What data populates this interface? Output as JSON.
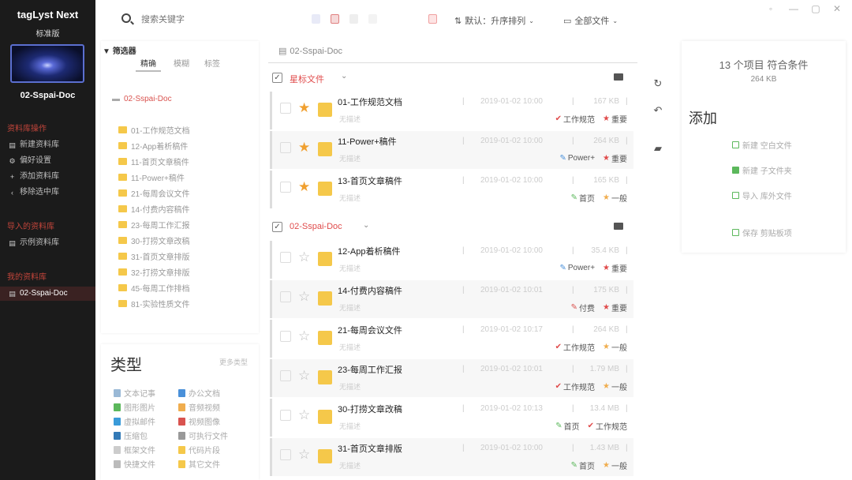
{
  "app": {
    "title": "tagLyst Next",
    "edition": "标准版",
    "library_name": "02-Sspai-Doc"
  },
  "sidebar": {
    "section1": "资料库操作",
    "items1": [
      {
        "icon": "library-icon",
        "label": "新建资料库"
      },
      {
        "icon": "gear-icon",
        "label": "偏好设置"
      },
      {
        "icon": "plus-icon",
        "label": "添加资料库"
      },
      {
        "icon": "back-icon",
        "label": "移除选中库"
      }
    ],
    "section2": "导入的资料库",
    "items2": [
      {
        "icon": "library-icon",
        "label": "示例资料库"
      }
    ],
    "section3": "我的资料库",
    "items3": [
      {
        "icon": "library-icon",
        "label": "02-Sspai-Doc"
      }
    ]
  },
  "toolbar": {
    "search_placeholder": "搜索关键字",
    "sort_label": "默认：升序排列",
    "scope_label": "全部文件",
    "sort_icon": "sort-icon",
    "scope_icon": "file-icon"
  },
  "filter": {
    "label": "筛选器",
    "tabs": [
      "精确",
      "模糊",
      "标签"
    ],
    "root": "02-Sspai-Doc",
    "folders": [
      "01-工作规范文档",
      "12-App着析稿件",
      "11-首页文章稿件",
      "11-Power+稿件",
      "21-每周会议文件",
      "14-付费内容稿件",
      "23-每周工作汇报",
      "30-打捞文章改稿",
      "31-首页文章排版",
      "32-打捞文章排版",
      "45-每周工作排档",
      "81-实验性质文件"
    ]
  },
  "types": {
    "title": "类型",
    "more": "更多类型",
    "items": [
      {
        "label": "文本记事",
        "color": "#9ab9d6"
      },
      {
        "label": "办公文档",
        "color": "#4a90d9"
      },
      {
        "label": "图形图片",
        "color": "#5cb85c"
      },
      {
        "label": "音频视频",
        "color": "#f0ad4e"
      },
      {
        "label": "虚拟邮件",
        "color": "#3a9bd9"
      },
      {
        "label": "视频图像",
        "color": "#d9534f"
      },
      {
        "label": "压缩包",
        "color": "#337ab7"
      },
      {
        "label": "可执行文件",
        "color": "#999999"
      },
      {
        "label": "框架文件",
        "color": "#cccccc"
      },
      {
        "label": "代码片段",
        "color": "#f5c84a"
      },
      {
        "label": "快捷文件",
        "color": "#bbbbbb"
      },
      {
        "label": "其它文件",
        "color": "#f5c84a"
      }
    ]
  },
  "list": {
    "path": "02-Sspai-Doc",
    "groups": [
      {
        "name": "星标文件",
        "rows": [
          {
            "name": "01-工作规范文档",
            "desc": "无描述",
            "date": "2019-01-02 10:00",
            "size": "167 KB",
            "starred": true,
            "tags": [
              {
                "label": "工作规范",
                "color": "#e04b4b",
                "icon": "check-tag-icon"
              },
              {
                "label": "重要",
                "color": "#e04b4b",
                "icon": "star-tag-icon"
              }
            ]
          },
          {
            "name": "11-Power+稿件",
            "desc": "无描述",
            "date": "2019-01-02 10:00",
            "size": "264 KB",
            "starred": true,
            "tags": [
              {
                "label": "Power+",
                "color": "#4a90d9",
                "icon": "pen-tag-icon"
              },
              {
                "label": "重要",
                "color": "#e04b4b",
                "icon": "star-tag-icon"
              }
            ]
          },
          {
            "name": "13-首页文章稿件",
            "desc": "无描述",
            "date": "2019-01-02 10:00",
            "size": "165 KB",
            "starred": true,
            "tags": [
              {
                "label": "首页",
                "color": "#5cb85c",
                "icon": "pen-tag-icon"
              },
              {
                "label": "一般",
                "color": "#f0ad4e",
                "icon": "star-tag-icon"
              }
            ]
          }
        ]
      },
      {
        "name": "02-Sspai-Doc",
        "rows": [
          {
            "name": "12-App着析稿件",
            "desc": "无描述",
            "date": "2019-01-02 10:00",
            "size": "35.4 KB",
            "starred": false,
            "tags": [
              {
                "label": "Power+",
                "color": "#4a90d9",
                "icon": "pen-tag-icon"
              },
              {
                "label": "重要",
                "color": "#e04b4b",
                "icon": "star-tag-icon"
              }
            ]
          },
          {
            "name": "14-付费内容稿件",
            "desc": "无描述",
            "date": "2019-01-02 10:01",
            "size": "175 KB",
            "starred": false,
            "tags": [
              {
                "label": "付费",
                "color": "#d9534f",
                "icon": "pen-tag-icon"
              },
              {
                "label": "重要",
                "color": "#e04b4b",
                "icon": "star-tag-icon"
              }
            ]
          },
          {
            "name": "21-每周会议文件",
            "desc": "无描述",
            "date": "2019-01-02 10:17",
            "size": "264 KB",
            "starred": false,
            "tags": [
              {
                "label": "工作规范",
                "color": "#e04b4b",
                "icon": "check-tag-icon"
              },
              {
                "label": "一般",
                "color": "#f0ad4e",
                "icon": "star-tag-icon"
              }
            ]
          },
          {
            "name": "23-每周工作汇报",
            "desc": "无描述",
            "date": "2019-01-02 10:01",
            "size": "1.79 MB",
            "starred": false,
            "tags": [
              {
                "label": "工作规范",
                "color": "#e04b4b",
                "icon": "check-tag-icon"
              },
              {
                "label": "一般",
                "color": "#f0ad4e",
                "icon": "star-tag-icon"
              }
            ]
          },
          {
            "name": "30-打捞文章改稿",
            "desc": "无描述",
            "date": "2019-01-02 10:13",
            "size": "13.4 MB",
            "starred": false,
            "tags": [
              {
                "label": "首页",
                "color": "#5cb85c",
                "icon": "pen-tag-icon"
              },
              {
                "label": "工作规范",
                "color": "#e04b4b",
                "icon": "check-tag-icon"
              }
            ]
          },
          {
            "name": "31-首页文章排版",
            "desc": "无描述",
            "date": "2019-01-02 10:00",
            "size": "1.43 MB",
            "starred": false,
            "tags": [
              {
                "label": "首页",
                "color": "#5cb85c",
                "icon": "pen-tag-icon"
              },
              {
                "label": "一般",
                "color": "#f0ad4e",
                "icon": "star-tag-icon"
              }
            ]
          }
        ]
      }
    ]
  },
  "right_panel": {
    "match_count": "13 个项目 符合条件",
    "total_size": "264 KB",
    "add_title": "添加",
    "add_items": [
      "新建 空白文件",
      "新建 子文件夹",
      "导入 库外文件",
      "保存 剪贴板项"
    ]
  },
  "colors": {
    "accent": "#e04b4b",
    "star": "#f0a030",
    "folder": "#f5c84a",
    "sidebar_bg": "#1b1b1b"
  }
}
